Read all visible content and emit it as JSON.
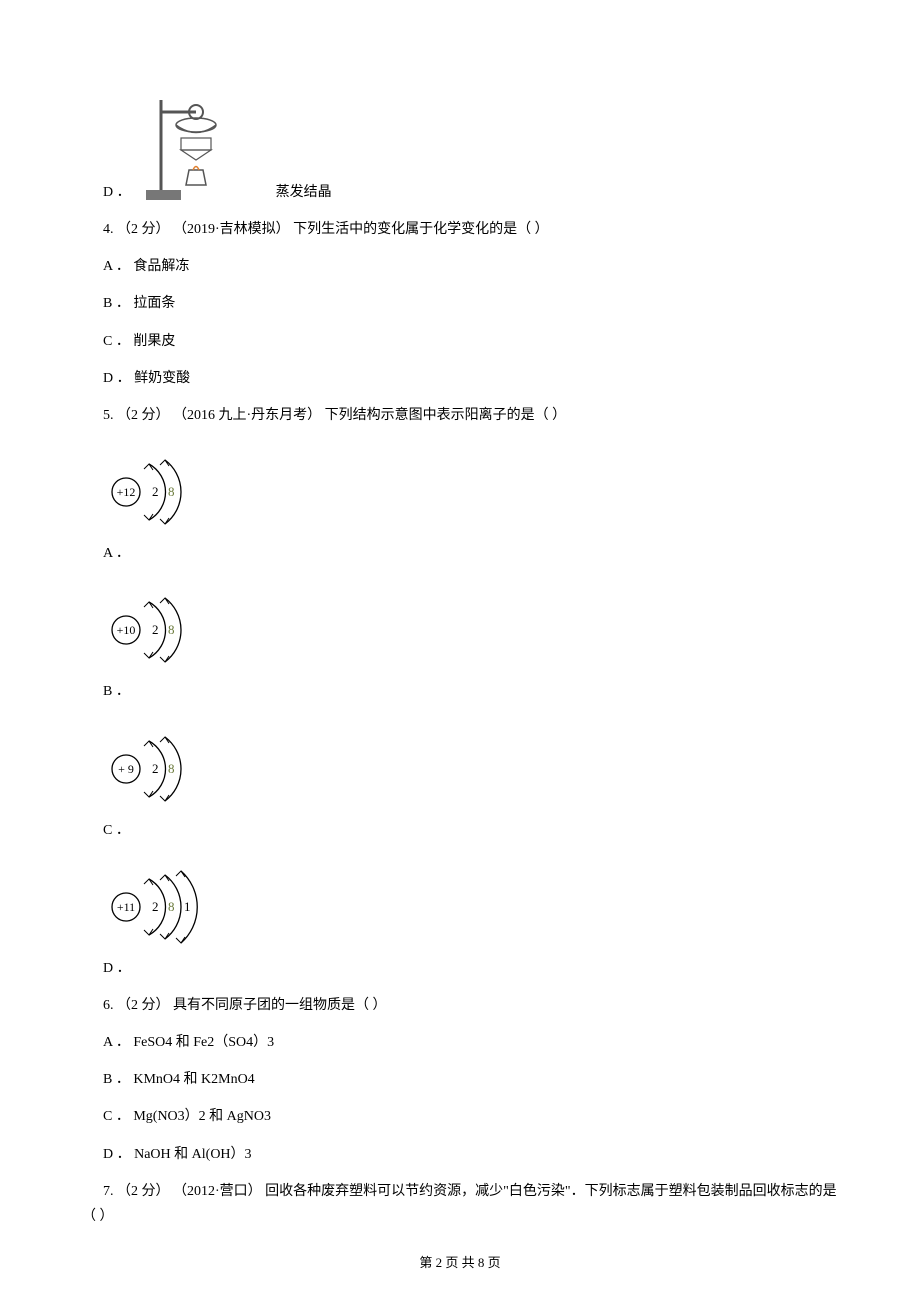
{
  "q3": {
    "optD": {
      "letter": "D ．",
      "text": "蒸发结晶"
    }
  },
  "q4": {
    "stem": "4.  （2 分） （2019·吉林模拟） 下列生活中的变化属于化学变化的是（    ）",
    "optA": "A ． 食品解冻",
    "optB": "B ． 拉面条",
    "optC": "C ． 削果皮",
    "optD": "D ． 鲜奶变酸"
  },
  "q5": {
    "stem": "5.  （2 分） （2016 九上·丹东月考） 下列结构示意图中表示阳离子的是（    ）",
    "optA": "A ．",
    "optB": "B ．",
    "optC": "C ．",
    "optD": "D ．",
    "diagA": {
      "nucleus": "+12",
      "shells": [
        "2",
        "8"
      ]
    },
    "diagB": {
      "nucleus": "+10",
      "shells": [
        "2",
        "8"
      ]
    },
    "diagC": {
      "nucleus": "+9",
      "shells": [
        "2",
        "8"
      ]
    },
    "diagD": {
      "nucleus": "+11",
      "shells": [
        "2",
        "8",
        "1"
      ]
    }
  },
  "q6": {
    "stem": "6.  （2 分） 具有不同原子团的一组物质是（    ）",
    "optA": "A ． FeSO4 和 Fe2（SO4）3",
    "optB": "B ． KMnO4 和 K2MnO4",
    "optC": "C ． Mg(NO3）2 和 AgNO3",
    "optD": "D ． NaOH 和 Al(OH）3"
  },
  "q7": {
    "stem": "7.  （2 分） （2012·营口） 回收各种废弃塑料可以节约资源，减少\"白色污染\"．下列标志属于塑料包装制品回收标志的是（    ）"
  },
  "footer": "第 2 页 共 8 页"
}
